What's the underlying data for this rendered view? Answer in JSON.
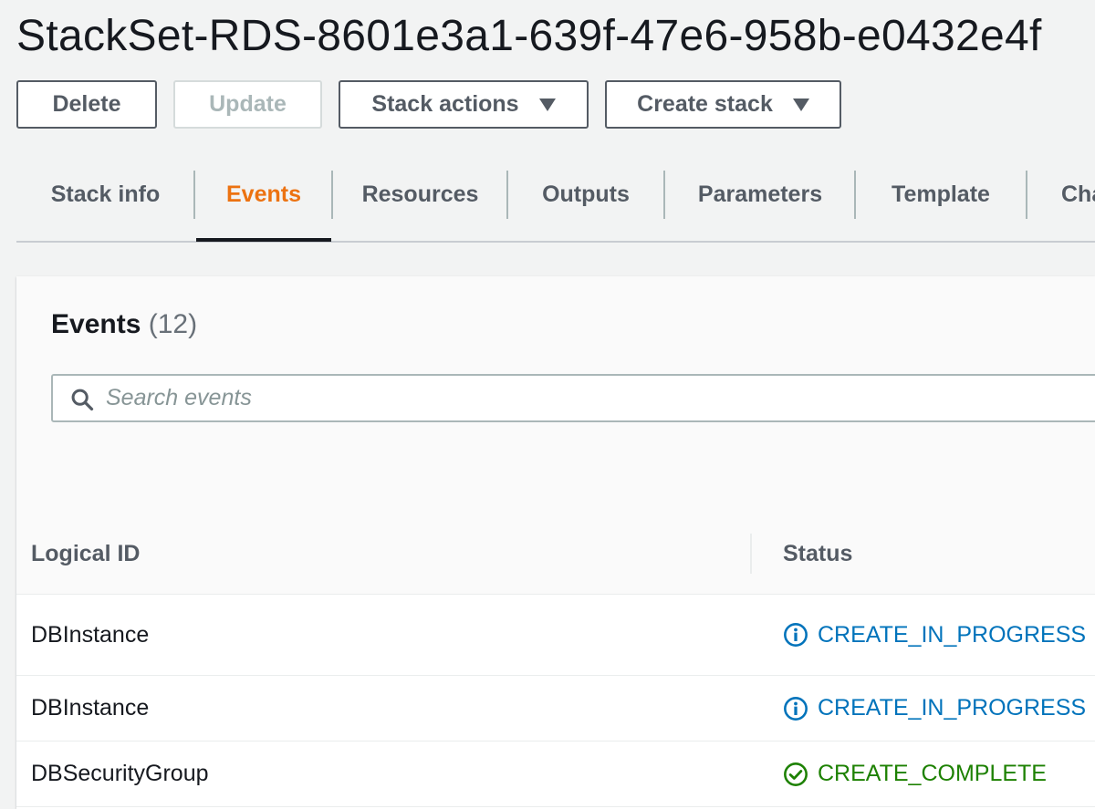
{
  "page": {
    "title": "StackSet-RDS-8601e3a1-639f-47e6-958b-e0432e4f"
  },
  "actions": {
    "delete_label": "Delete",
    "update_label": "Update",
    "stack_actions_label": "Stack actions",
    "create_stack_label": "Create stack"
  },
  "tabs": [
    {
      "label": "Stack info",
      "active": false
    },
    {
      "label": "Events",
      "active": true
    },
    {
      "label": "Resources",
      "active": false
    },
    {
      "label": "Outputs",
      "active": false
    },
    {
      "label": "Parameters",
      "active": false
    },
    {
      "label": "Template",
      "active": false
    },
    {
      "label": "Cha",
      "active": false
    }
  ],
  "events": {
    "title": "Events",
    "count": "(12)",
    "search_placeholder": "Search events",
    "columns": [
      "Logical ID",
      "Status"
    ],
    "rows": [
      {
        "logical_id": "DBInstance",
        "status": "CREATE_IN_PROGRESS",
        "status_type": "info",
        "status_icon": "info-circle-icon"
      },
      {
        "logical_id": "DBInstance",
        "status": "CREATE_IN_PROGRESS",
        "status_type": "info",
        "status_icon": "info-circle-icon"
      },
      {
        "logical_id": "DBSecurityGroup",
        "status": "CREATE_COMPLETE",
        "status_type": "success",
        "status_icon": "check-circle-icon"
      }
    ]
  },
  "colors": {
    "accent": "#ec7211",
    "info": "#0073bb",
    "success": "#1d8102",
    "text": "#16191f",
    "secondary_text": "#545b64"
  }
}
